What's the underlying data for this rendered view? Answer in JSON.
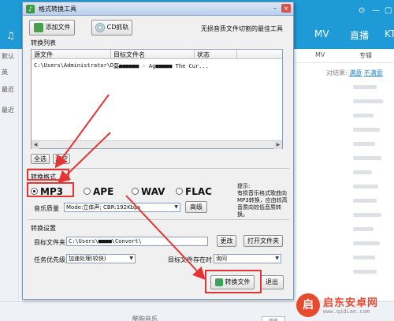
{
  "background": {
    "nav": [
      "MV",
      "直播",
      "KT"
    ],
    "subnav": [
      "MV",
      "专辑"
    ],
    "result_label": "对结果:",
    "result_links": [
      "满意",
      "不满意"
    ],
    "left_items": [
      "默认",
      "最近",
      "最近"
    ],
    "left_tab": "英",
    "now_playing": "酷狗音乐",
    "bottom_select": "原声",
    "watermark": {
      "brand_cn": "启东安卓网",
      "brand_url": "www.qidian.com"
    }
  },
  "window": {
    "title": "格式转换工具",
    "add_file_btn": "添加文件",
    "cd_grab_btn": "CD抓轨",
    "slogan": "无损音质文件切割的最佳工具",
    "file_list_label": "转换列表",
    "columns": [
      "源文件",
      "目标文件名",
      "状态"
    ],
    "rows": [
      {
        "source": "C:\\Users\\Administrator\\D...",
        "target": "莫■■■■■■ - Ag■■■■■ The Cur...",
        "status": ""
      }
    ],
    "select_all_btn": "全选",
    "clear_btn": "清空",
    "format_label": "转换格式",
    "formats": [
      {
        "label": "MP3",
        "selected": true
      },
      {
        "label": "APE",
        "selected": false
      },
      {
        "label": "WAV",
        "selected": false
      },
      {
        "label": "FLAC",
        "selected": false
      }
    ],
    "hint_title": "提示:",
    "hint_text": "有损音乐格式歌曲向MP3转换，应由较高音质向较低音质转换。",
    "quality_label": "音乐质量",
    "quality_value": "Mode:立体声; CBR:192Kbps",
    "advanced_btn": "高级",
    "settings_label": "转换设置",
    "target_folder_label": "目标文件夹",
    "target_folder_value": "C:\\Users\\■■■■\\Convert\\",
    "change_btn": "更改",
    "open_folder_btn": "打开文件夹",
    "priority_label": "任务优先级",
    "priority_value": "加速处理(较快)",
    "exists_label": "目标文件存在时",
    "exists_value": "询问",
    "convert_btn": "转换文件",
    "exit_btn": "退出"
  },
  "colors": {
    "highlight": "#e53434",
    "app_blue": "#1e9ad6",
    "brand_red": "#e84a2f"
  }
}
